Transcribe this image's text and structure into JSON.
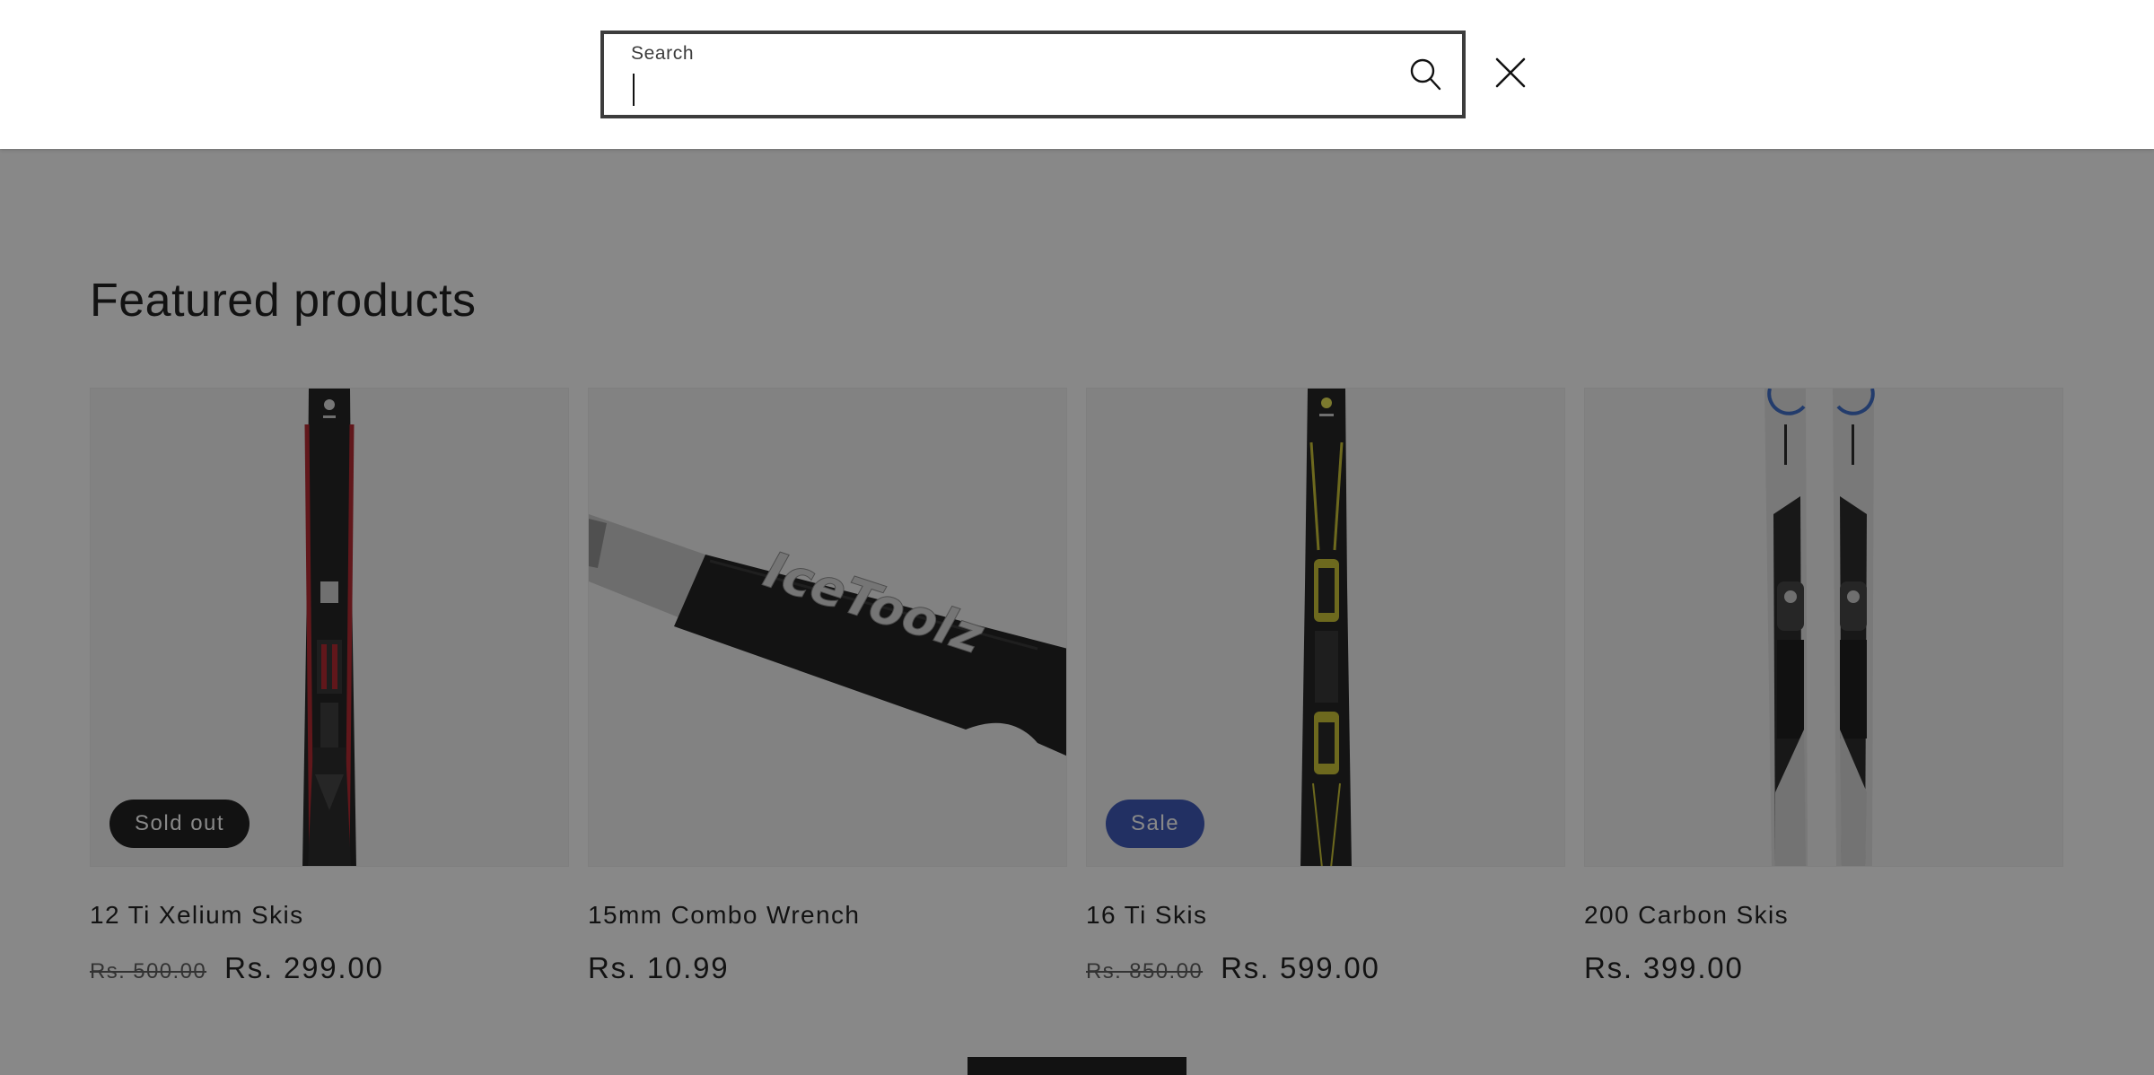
{
  "search": {
    "label": "Search",
    "value": "",
    "submit_icon": "search-icon",
    "close_icon": "close-icon"
  },
  "section": {
    "title": "Featured products"
  },
  "products": [
    {
      "title": "12 Ti Xelium Skis",
      "price_old": "Rs. 500.00",
      "price_new": "Rs. 299.00",
      "badge": "Sold out",
      "image": "red-black-ski"
    },
    {
      "title": "15mm Combo Wrench",
      "price_old": "",
      "price_new": "Rs. 10.99",
      "badge": "",
      "image": "icetoolz-wrench",
      "image_text": "IceToolz"
    },
    {
      "title": "16 Ti Skis",
      "price_old": "Rs. 850.00",
      "price_new": "Rs. 599.00",
      "badge": "Sale",
      "image": "yellow-black-ski"
    },
    {
      "title": "200 Carbon Skis",
      "price_old": "",
      "price_new": "Rs. 399.00",
      "badge": "",
      "image": "grey-skis-pair"
    }
  ],
  "colors": {
    "overlay": "#121212",
    "sale_badge": "#334fb4",
    "sold_out_badge": "#121212",
    "text": "#121212"
  }
}
